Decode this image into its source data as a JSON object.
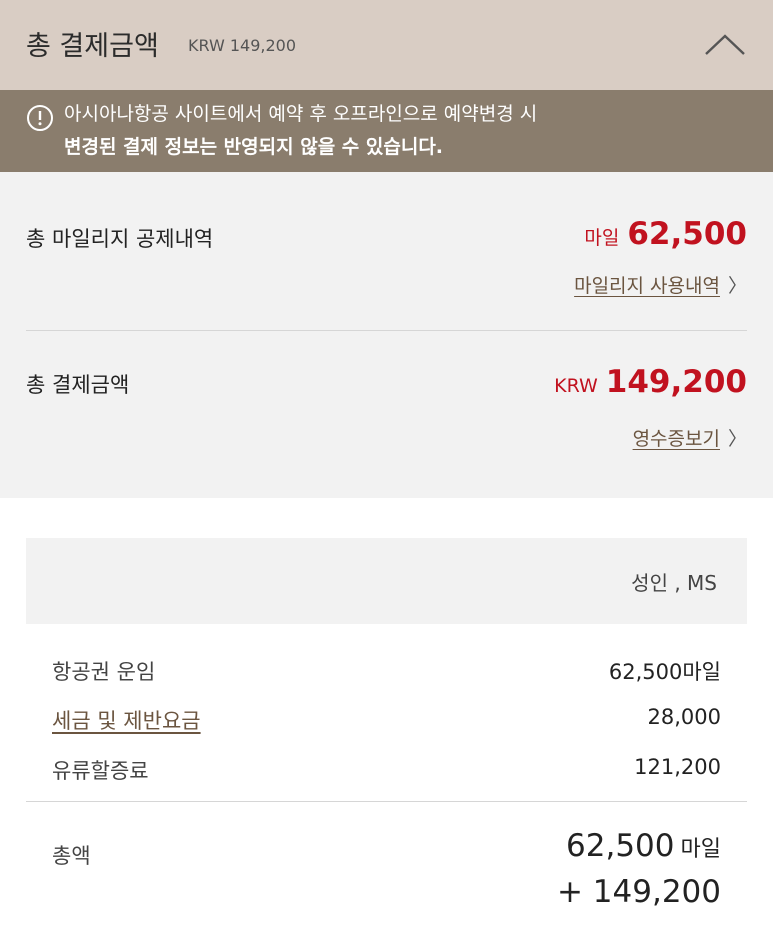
{
  "header": {
    "title": "총 결제금액",
    "currency_amount": "KRW  149,200"
  },
  "icons": {
    "collapse": "chevron-up-icon",
    "notice": "info-circle-icon",
    "link_arrow": "chevron-right-icon"
  },
  "notice": {
    "line1": "아시아나항공 사이트에서 예약 후 오프라인으로 예약변경 시",
    "line2": "변경된 결제 정보는 반영되지 않을 수 있습니다."
  },
  "summary": {
    "mileage": {
      "label": "총 마일리지 공제내역",
      "unit": "마일",
      "value": "62,500",
      "link": "마일리지 사용내역"
    },
    "payment": {
      "label": "총 결제금액",
      "unit": "KRW",
      "value": "149,200",
      "link": "영수증보기"
    }
  },
  "passenger": {
    "label": "성인 , MS"
  },
  "fares": [
    {
      "label": "항공권 운임",
      "value": "62,500마일"
    },
    {
      "label": "세금 및 제반요금",
      "value": "28,000"
    },
    {
      "label": "유류할증료",
      "value": "121,200"
    }
  ],
  "total": {
    "label": "총액",
    "mileage_value": "62,500",
    "mileage_unit": "마일",
    "krw_value": "+ 149,200"
  },
  "colors": {
    "header_bg": "#d9cdc4",
    "notice_bg": "#8a7d6d",
    "summary_bg": "#f2f2f2",
    "accent_red": "#c1121f",
    "link_brown": "#6b5540"
  }
}
